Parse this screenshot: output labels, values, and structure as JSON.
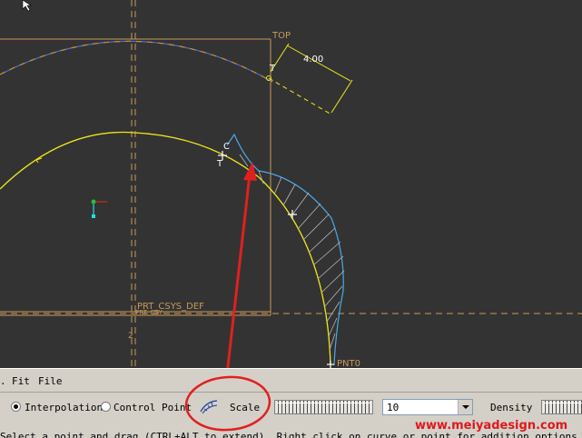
{
  "viewport": {
    "datum_labels": {
      "top": "TOP",
      "csys": "PRT_CSYS_DEF",
      "point": "PNT0",
      "csys_small": "PRT_CSY",
      "sketch_c": "C",
      "sketch_t": "T"
    },
    "dimension_value": "4.00"
  },
  "menubar": {
    "items": [
      "Fit",
      "File"
    ]
  },
  "toolbar": {
    "interpolation_label": "Interpolation",
    "control_point_label": "Control Point",
    "scale_label": "Scale",
    "density_value": "10",
    "density_label": "Density",
    "selected_mode": "Interpolation"
  },
  "statusbar": {
    "message": "Select a point and drag (CTRL+ALT to extend). Right click on curve or point for addition options."
  },
  "watermark": "www.meiyadesign.com",
  "colors": {
    "background": "#333333",
    "datum": "#c89a58",
    "arc_blue": "#4a6fd0",
    "arc_yellow": "#f0e818",
    "curve_cyan": "#4aa8e8",
    "annotation_red": "#e02020",
    "panel": "#d4d0c8"
  }
}
